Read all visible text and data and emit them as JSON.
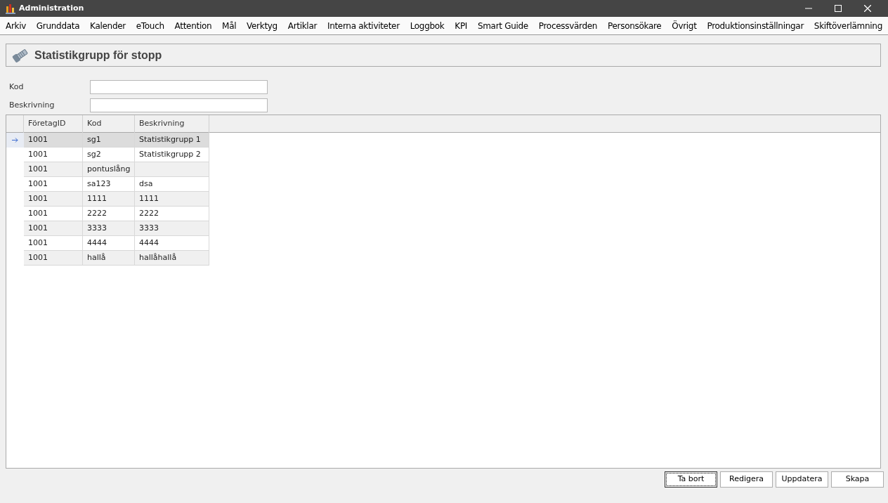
{
  "window": {
    "title": "Administration"
  },
  "menu": [
    {
      "label": "Arkiv"
    },
    {
      "label": "Grunddata"
    },
    {
      "label": "Kalender"
    },
    {
      "label": "eTouch"
    },
    {
      "label": "Attention"
    },
    {
      "label": "Mål"
    },
    {
      "label": "Verktyg"
    },
    {
      "label": "Artiklar"
    },
    {
      "label": "Interna aktiviteter"
    },
    {
      "label": "Loggbok"
    },
    {
      "label": "KPI"
    },
    {
      "label": "Smart Guide"
    },
    {
      "label": "Processvärden"
    },
    {
      "label": "Personsökare"
    },
    {
      "label": "Övrigt"
    },
    {
      "label": "Produktionsinställningar"
    },
    {
      "label": "Skiftöverlämning"
    }
  ],
  "header": {
    "title": "Statistikgrupp för stopp"
  },
  "fields": [
    {
      "label": "Kod"
    },
    {
      "label": "Beskrivning"
    }
  ],
  "table": {
    "columns": [
      "FöretagID",
      "Kod",
      "Beskrivning"
    ],
    "rows": [
      {
        "cells": [
          "1001",
          "sg1",
          "Statistikgrupp 1"
        ],
        "selected": true
      },
      {
        "cells": [
          "1001",
          "sg2",
          "Statistikgrupp 2"
        ],
        "selected": false
      },
      {
        "cells": [
          "1001",
          "pontuslång",
          ""
        ],
        "selected": false
      },
      {
        "cells": [
          "1001",
          "sa123",
          "dsa"
        ],
        "selected": false
      },
      {
        "cells": [
          "1001",
          "1111",
          "1111"
        ],
        "selected": false
      },
      {
        "cells": [
          "1001",
          "2222",
          "2222"
        ],
        "selected": false
      },
      {
        "cells": [
          "1001",
          "3333",
          "3333"
        ],
        "selected": false
      },
      {
        "cells": [
          "1001",
          "4444",
          "4444"
        ],
        "selected": false
      },
      {
        "cells": [
          "1001",
          "hallå",
          "hallåhallå"
        ],
        "selected": false
      }
    ]
  },
  "buttons": [
    {
      "label": "Ta bort",
      "focused": true
    },
    {
      "label": "Redigera",
      "focused": false
    },
    {
      "label": "Uppdatera",
      "focused": false
    },
    {
      "label": "Skapa",
      "focused": false
    }
  ]
}
